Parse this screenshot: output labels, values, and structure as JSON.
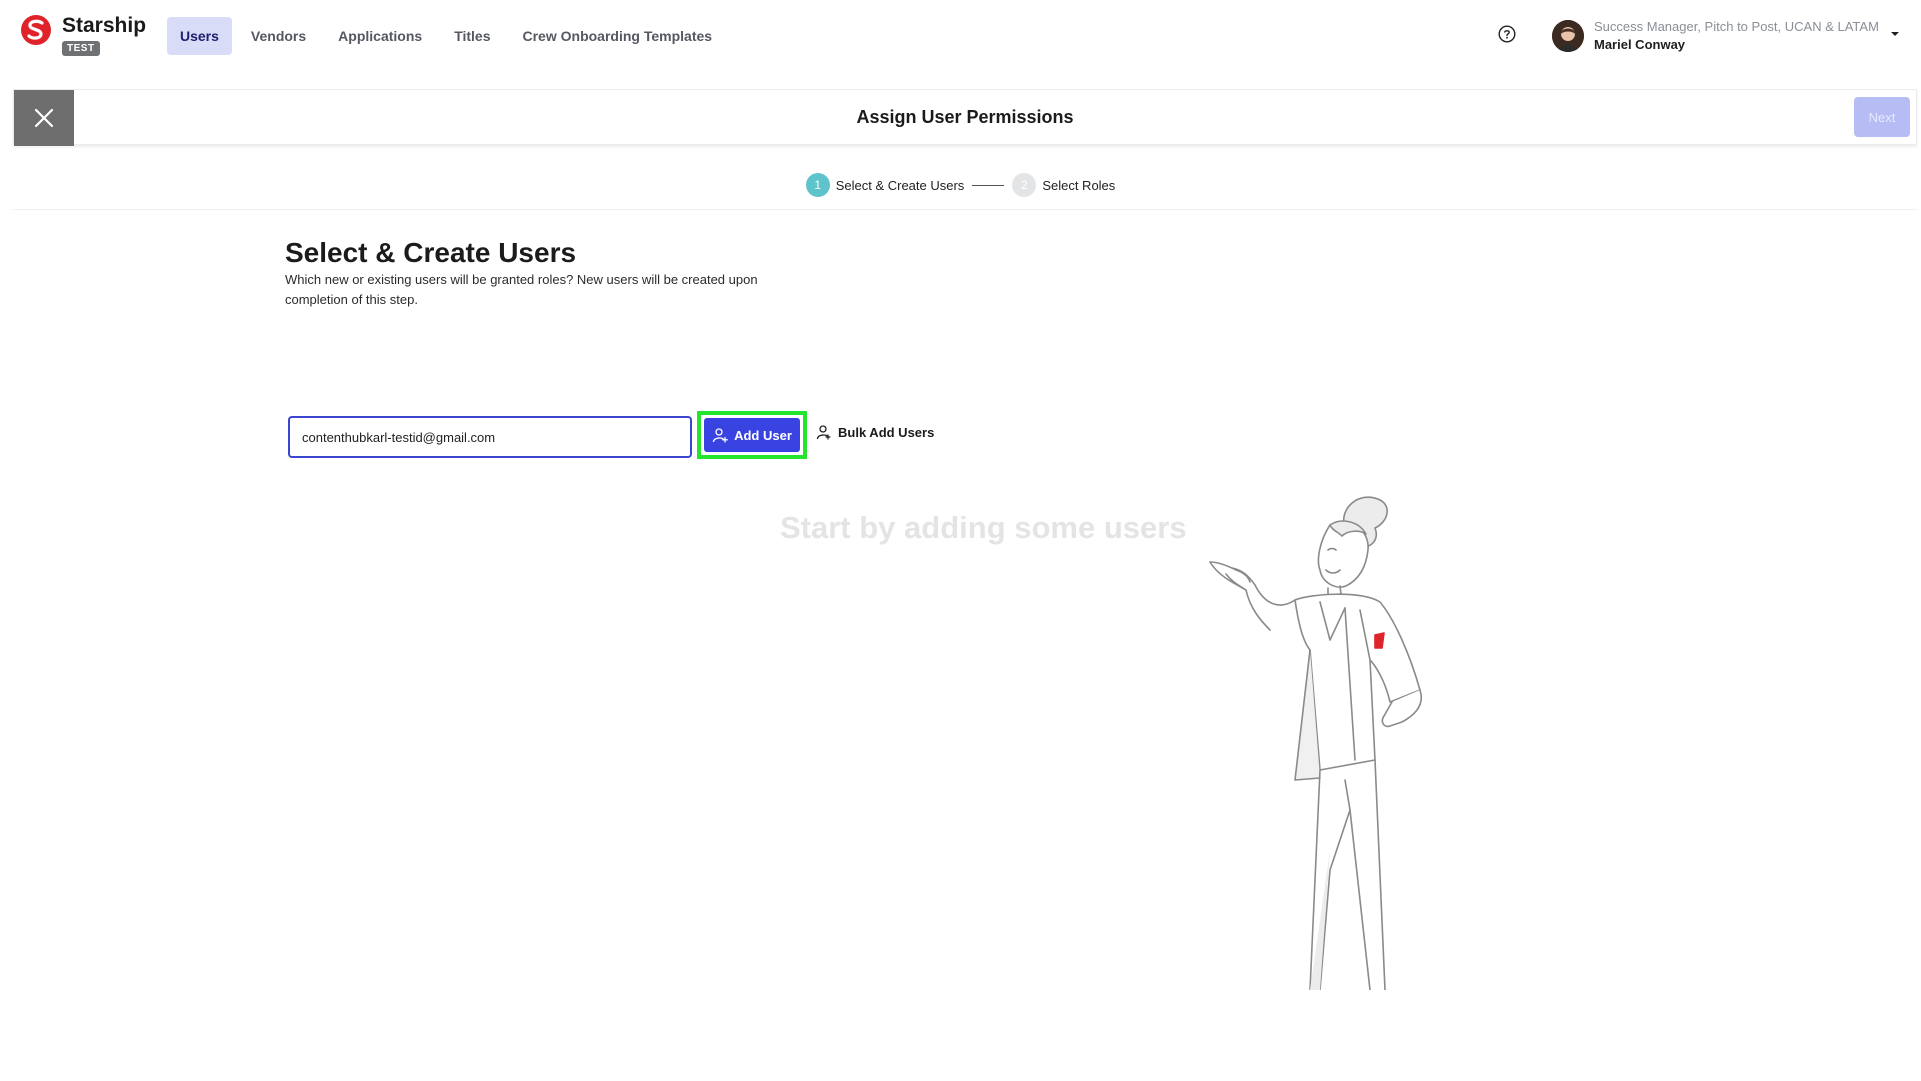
{
  "brand": {
    "name": "Starship",
    "badge": "TEST",
    "color": "#e0232a"
  },
  "nav": {
    "tabs": [
      {
        "label": "Users",
        "active": true
      },
      {
        "label": "Vendors",
        "active": false
      },
      {
        "label": "Applications",
        "active": false
      },
      {
        "label": "Titles",
        "active": false
      },
      {
        "label": "Crew Onboarding Templates",
        "active": false
      }
    ]
  },
  "user": {
    "role": "Success Manager, Pitch to Post, UCAN & LATAM",
    "name": "Mariel Conway"
  },
  "header": {
    "title": "Assign User Permissions",
    "next_label": "Next"
  },
  "stepper": {
    "steps": [
      {
        "number": "1",
        "label": "Select & Create Users",
        "active": true
      },
      {
        "number": "2",
        "label": "Select Roles",
        "active": false
      }
    ]
  },
  "section": {
    "title": "Select & Create Users",
    "description": "Which new or existing users will be granted roles? New users will be created upon completion of this step."
  },
  "form": {
    "email_value": "contenthubkarl-testid@gmail.com",
    "add_user_label": "Add User",
    "bulk_add_label": "Bulk Add Users"
  },
  "empty_state": {
    "text": "Start by adding some users"
  },
  "colors": {
    "accent": "#3943e2",
    "highlight": "#23e52d",
    "step_active": "#5fc3cc"
  }
}
